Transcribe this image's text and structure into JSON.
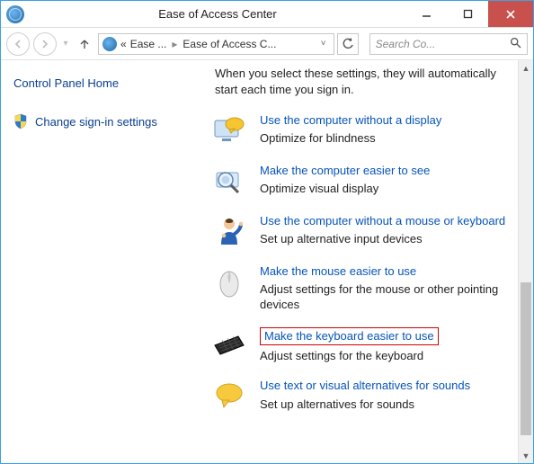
{
  "window": {
    "title": "Ease of Access Center"
  },
  "nav": {
    "crumb_prefix": "«",
    "crumb1": "Ease ...",
    "crumb2": "Ease of Access C...",
    "search_placeholder": "Search Co..."
  },
  "sidebar": {
    "control_panel_home": "Control Panel Home",
    "change_signin": "Change sign-in settings"
  },
  "content": {
    "intro": "When you select these settings, they will automatically start each time you sign in.",
    "options": [
      {
        "link": "Use the computer without a display",
        "desc": "Optimize for blindness",
        "icon": "display-bubble-icon"
      },
      {
        "link": "Make the computer easier to see",
        "desc": "Optimize visual display",
        "icon": "magnifier-icon"
      },
      {
        "link": "Use the computer without a mouse or keyboard",
        "desc": "Set up alternative input devices",
        "icon": "person-icon"
      },
      {
        "link": "Make the mouse easier to use",
        "desc": "Adjust settings for the mouse or other pointing devices",
        "icon": "mouse-icon"
      },
      {
        "link": "Make the keyboard easier to use",
        "desc": "Adjust settings for the keyboard",
        "icon": "keyboard-icon",
        "highlighted": true
      },
      {
        "link": "Use text or visual alternatives for sounds",
        "desc": "Set up alternatives for sounds",
        "icon": "sound-bubble-icon"
      }
    ]
  },
  "colors": {
    "link": "#0654ba",
    "highlight_border": "#c00",
    "accent": "#3aa3e3"
  }
}
